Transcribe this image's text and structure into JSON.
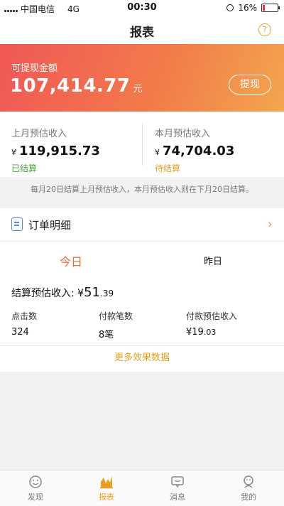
{
  "status_bar": {
    "carrier": "中国电信",
    "network": "4G",
    "time": "00:30",
    "battery": "16%",
    "battery_level": 0.16
  },
  "nav": {
    "title": "报表",
    "help_symbol": "?"
  },
  "balance": {
    "label": "可提现金额",
    "amount": "107,414.77",
    "unit": "元",
    "withdraw_label": "提现"
  },
  "income": {
    "last_month": {
      "label": "上月预估收入",
      "currency": "¥",
      "value": "119,915.73",
      "status": "已结算"
    },
    "this_month": {
      "label": "本月预估收入",
      "currency": "¥",
      "value": "74,704.03",
      "status": "待结算"
    }
  },
  "settlement_note": "每月20日结算上月预估收入，本月预估收入则在下月20日结算。",
  "orders": {
    "title": "订单明细",
    "chevron": "›"
  },
  "day_tabs": {
    "today": "今日",
    "yesterday": "昨日"
  },
  "settle_today": {
    "label": "结算预估收入:",
    "currency": "¥",
    "value_int": "51",
    "value_dec": ".39"
  },
  "stats": {
    "clicks": {
      "label": "点击数",
      "value": "324"
    },
    "payments": {
      "label": "付款笔数",
      "value": "8笔"
    },
    "paid_income": {
      "label": "付款预估收入",
      "currency": "¥",
      "value_int": "19",
      "value_dec": ".03"
    }
  },
  "more_link": "更多效果数据",
  "tab_bar": [
    {
      "label": "发现",
      "icon": "discover-icon",
      "active": false
    },
    {
      "label": "报表",
      "icon": "report-icon",
      "active": true
    },
    {
      "label": "消息",
      "icon": "message-icon",
      "active": false
    },
    {
      "label": "我的",
      "icon": "profile-icon",
      "active": false
    }
  ],
  "colors": {
    "accent": "#e9a020",
    "today_tab": "#e86a3b",
    "settled": "#4aa03c",
    "gradient_start": "#f05757",
    "gradient_end": "#f3a64e"
  }
}
